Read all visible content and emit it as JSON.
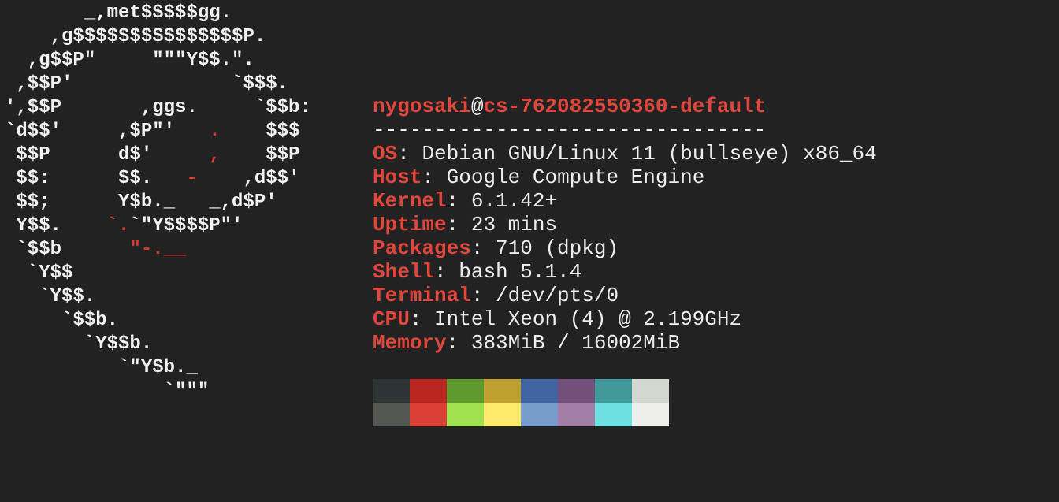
{
  "logo": {
    "lines": [
      [
        {
          "t": "       _,met$$$$$gg.",
          "c": "w"
        }
      ],
      [
        {
          "t": "    ,g$$$$$$$$$$$$$$$P.",
          "c": "w"
        }
      ],
      [
        {
          "t": "  ,g$$P\"     \"\"\"Y$$.\".",
          "c": "w"
        }
      ],
      [
        {
          "t": " ,$$P'              `$$$.",
          "c": "w"
        }
      ],
      [
        {
          "t": "',$$P       ,ggs.     `$$b:",
          "c": "w"
        }
      ],
      [
        {
          "t": "`d$$'     ,$P\"'   ",
          "c": "w"
        },
        {
          "t": ".",
          "c": "r"
        },
        {
          "t": "    $$$",
          "c": "w"
        }
      ],
      [
        {
          "t": " $$P      d$'     ",
          "c": "w"
        },
        {
          "t": ",",
          "c": "r"
        },
        {
          "t": "    $$P",
          "c": "w"
        }
      ],
      [
        {
          "t": " $$:      $$.   ",
          "c": "w"
        },
        {
          "t": "-",
          "c": "r"
        },
        {
          "t": "    ,d$$'",
          "c": "w"
        }
      ],
      [
        {
          "t": " $$;      Y$b._   _,d$P'",
          "c": "w"
        }
      ],
      [
        {
          "t": " Y$$.    ",
          "c": "w"
        },
        {
          "t": "`.",
          "c": "r"
        },
        {
          "t": "`\"Y$$$$P\"'",
          "c": "w"
        }
      ],
      [
        {
          "t": " `$$b      ",
          "c": "w"
        },
        {
          "t": "\"-.__",
          "c": "r"
        }
      ],
      [
        {
          "t": "  `Y$$",
          "c": "w"
        }
      ],
      [
        {
          "t": "   `Y$$.",
          "c": "w"
        }
      ],
      [
        {
          "t": "     `$$b.",
          "c": "w"
        }
      ],
      [
        {
          "t": "       `Y$$b.",
          "c": "w"
        }
      ],
      [
        {
          "t": "          `\"Y$b._",
          "c": "w"
        }
      ],
      [
        {
          "t": "              `\"\"\"",
          "c": "w"
        }
      ]
    ]
  },
  "header": {
    "user": "nygosaki",
    "at": "@",
    "host": "cs-762082550360-default",
    "separator": "--------------------------------"
  },
  "info": [
    {
      "key": "OS",
      "value": "Debian GNU/Linux 11 (bullseye) x86_64"
    },
    {
      "key": "Host",
      "value": "Google Compute Engine"
    },
    {
      "key": "Kernel",
      "value": "6.1.42+"
    },
    {
      "key": "Uptime",
      "value": "23 mins"
    },
    {
      "key": "Packages",
      "value": "710 (dpkg)"
    },
    {
      "key": "Shell",
      "value": "bash 5.1.4"
    },
    {
      "key": "Terminal",
      "value": "/dev/pts/0"
    },
    {
      "key": "CPU",
      "value": "Intel Xeon (4) @ 2.199GHz"
    },
    {
      "key": "Memory",
      "value": "383MiB / 16002MiB"
    }
  ],
  "key_separator": ": ",
  "colors": {
    "background": "#222222",
    "accent": "#e0463c",
    "text": "#ececec"
  },
  "palette": {
    "normal": [
      "#2e3436",
      "#b8261f",
      "#5e9a2e",
      "#c1a032",
      "#3f64a1",
      "#735079",
      "#42999a",
      "#d3d7cf"
    ],
    "bright": [
      "#555753",
      "#dc3f35",
      "#9fe14f",
      "#fde96b",
      "#789ccb",
      "#a37fa8",
      "#6ee0e1",
      "#eeeeec"
    ]
  }
}
